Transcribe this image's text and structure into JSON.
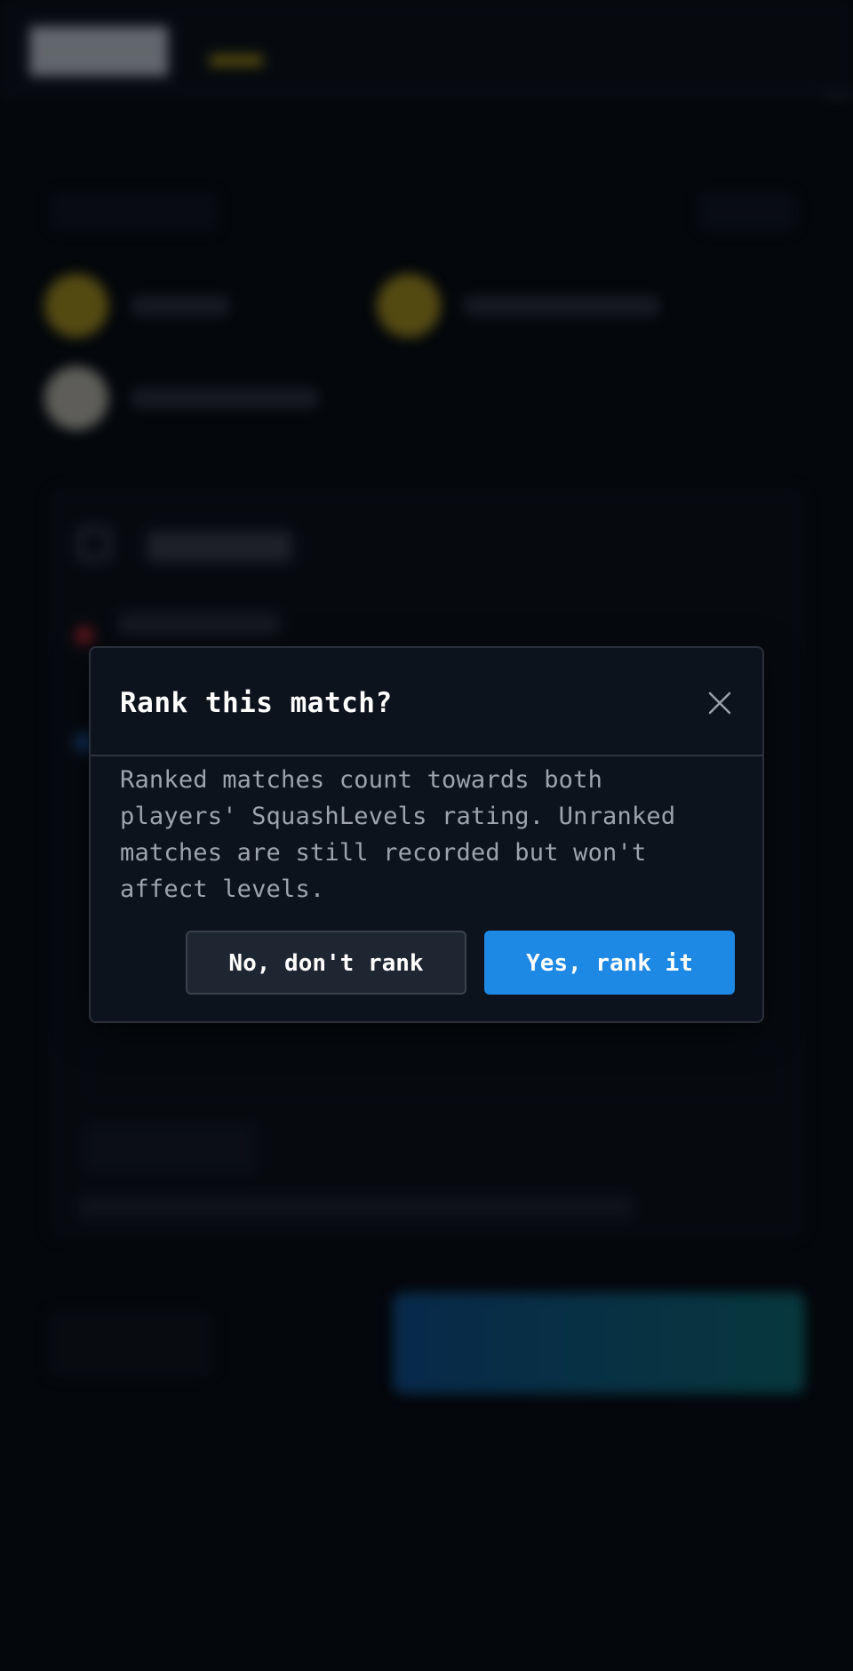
{
  "modal": {
    "title": "Rank this match?",
    "body": "Ranked matches count towards both players' SquashLevels rating. Unranked matches are still recorded but won't affect levels.",
    "cancel_label": "No, don't rank",
    "confirm_label": "Yes, rank it",
    "close_icon": "close-icon"
  },
  "colors": {
    "primary": "#1e88e5",
    "modal_bg": "#0d131d",
    "page_bg": "#05080d"
  }
}
